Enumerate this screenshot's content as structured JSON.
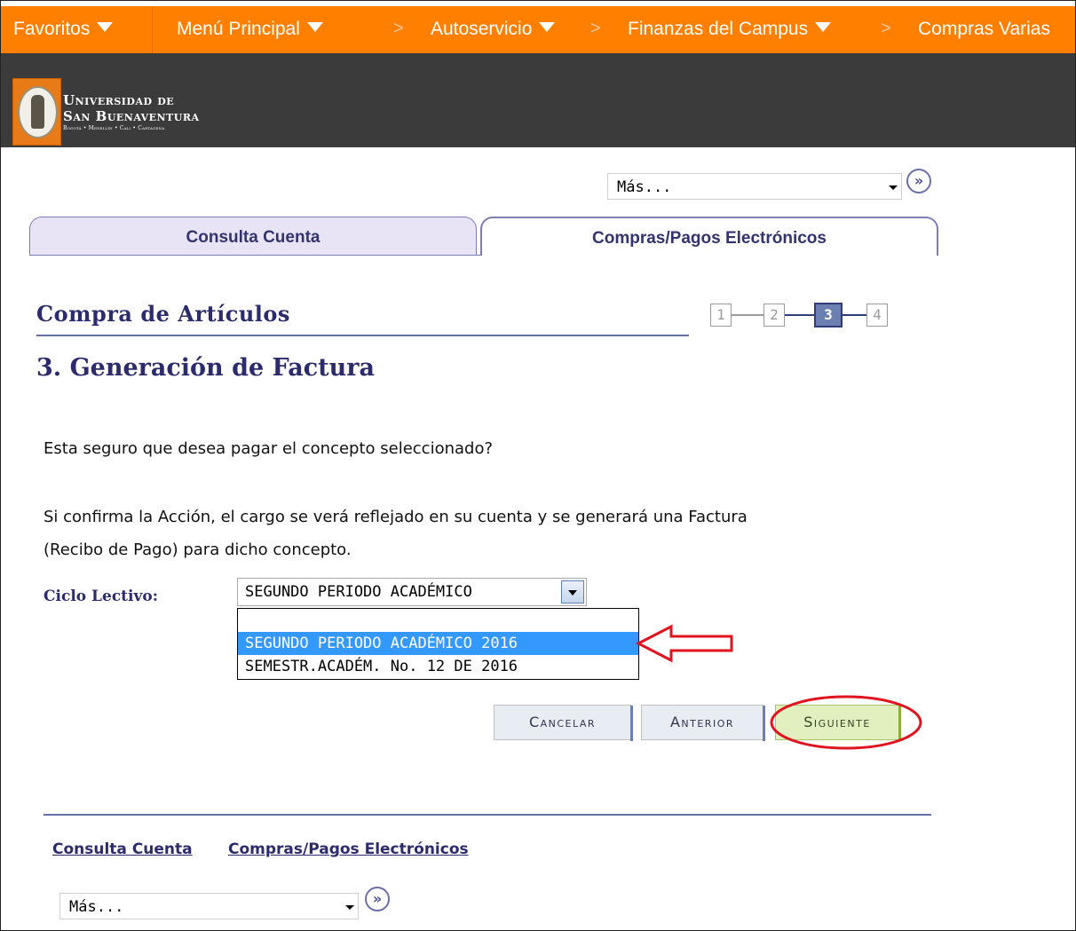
{
  "menu": {
    "items": [
      {
        "label": "Favoritos",
        "has_dropdown": true
      },
      {
        "label": "Menú Principal",
        "has_dropdown": true
      },
      {
        "label": "Autoservicio",
        "has_dropdown": true
      },
      {
        "label": "Finanzas del Campus",
        "has_dropdown": true
      },
      {
        "label": "Compras Varias",
        "has_dropdown": false
      }
    ],
    "separator": ">",
    "colors": {
      "bar": "#ff7f00",
      "text": "#ffffff"
    }
  },
  "header": {
    "logo_line1": "Universidad de",
    "logo_line2": "San Buenaventura",
    "logo_line3": "Bogotá • Medellín • Cali • Cartagena",
    "logo_icon": "university-seal-icon",
    "colors": {
      "background": "#3b3b3b"
    }
  },
  "top_nav": {
    "selected": "Más...",
    "go_icon": "double-chevron-right-icon"
  },
  "tabs": [
    {
      "label": "Consulta Cuenta",
      "active": false
    },
    {
      "label": "Compras/Pagos Electrónicos",
      "active": true
    }
  ],
  "page": {
    "title": "Compra de Artículos",
    "step_title": "3. Generación de Factura",
    "steps": [
      "1",
      "2",
      "3",
      "4"
    ],
    "current_step": 3
  },
  "content": {
    "question": "Esta seguro que desea pagar el concepto seleccionado?",
    "info_line1": "Si confirma la Acción, el cargo se verá reflejado en su cuenta y se generará una Factura",
    "info_line2": "(Recibo de Pago) para dicho concepto."
  },
  "cycle": {
    "label": "Ciclo Lectivo:",
    "value": "SEGUNDO PERIODO ACADÉMICO",
    "options": [
      "",
      "SEGUNDO PERIODO ACADÉMICO 2016",
      "SEMESTR.ACADÉM. No. 12 DE 2016"
    ],
    "highlighted_option": 1
  },
  "buttons": {
    "cancel": "Cancelar",
    "previous": "Anterior",
    "next": "Siguiente"
  },
  "footer": {
    "links": [
      "Consulta Cuenta",
      "Compras/Pagos Electrónicos"
    ],
    "selected": "Más...",
    "go_icon": "double-chevron-right-icon"
  },
  "annotations": {
    "arrow_color": "#e0141e",
    "circle_color": "#e0141e"
  }
}
